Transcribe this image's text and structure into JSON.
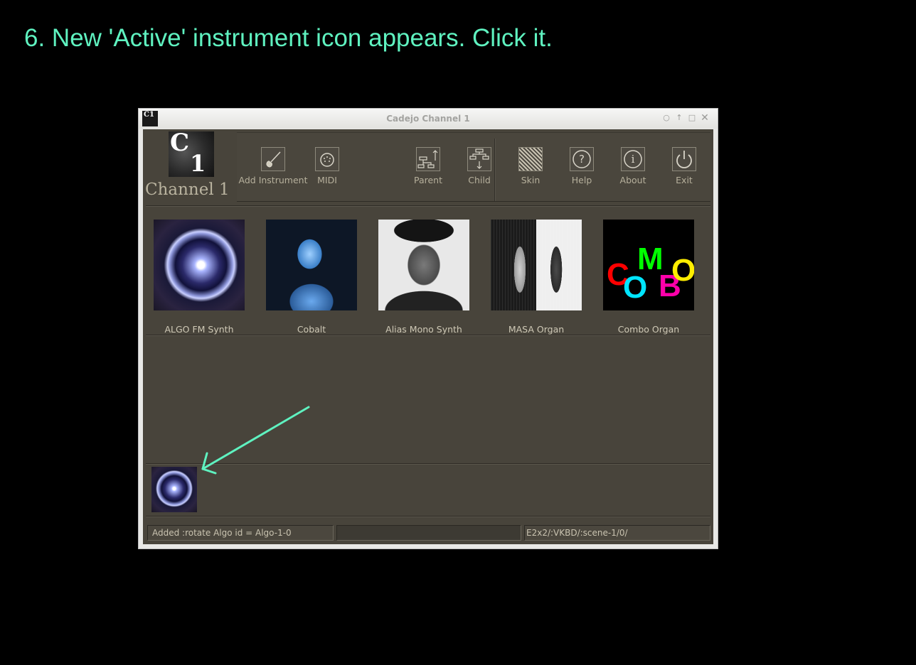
{
  "caption": "6. New 'Active' instrument icon appears.  Click it.",
  "window": {
    "title": "Cadejo Channel 1",
    "icon_text": "C1",
    "controls": [
      "circle-icon",
      "arrow-up-icon",
      "maximize-icon",
      "close-icon"
    ]
  },
  "header": {
    "logo_letter": "C",
    "logo_number": "1",
    "channel_label": "Channel 1"
  },
  "toolbar": {
    "tools": [
      {
        "label": "Add Instrument",
        "icon": "violin-icon"
      },
      {
        "label": "MIDI",
        "icon": "midi-connector-icon"
      },
      {
        "label": "Parent",
        "icon": "tree-up-icon"
      },
      {
        "label": "Child",
        "icon": "tree-down-icon"
      },
      {
        "label": "Skin",
        "icon": "texture-icon"
      },
      {
        "label": "Help",
        "icon": "question-icon"
      },
      {
        "label": "About",
        "icon": "info-icon"
      },
      {
        "label": "Exit",
        "icon": "power-icon"
      }
    ]
  },
  "instruments": [
    {
      "label": "ALGO FM Synth"
    },
    {
      "label": "Cobalt"
    },
    {
      "label": "Alias Mono Synth"
    },
    {
      "label": "MASA Organ"
    },
    {
      "label": "Combo Organ"
    }
  ],
  "combo_letters": [
    "C",
    "O",
    "M",
    "B",
    "O"
  ],
  "active_instrument": {
    "name": "Algo-1-0"
  },
  "status": {
    "message": "Added :rotate Algo id = Algo-1-0",
    "progress": "",
    "path": "E2x2/:VKBD/:scene-1/0/"
  },
  "colors": {
    "caption": "#5ff2c0",
    "panel": "#48443b",
    "arrow": "#5ff2c0"
  }
}
